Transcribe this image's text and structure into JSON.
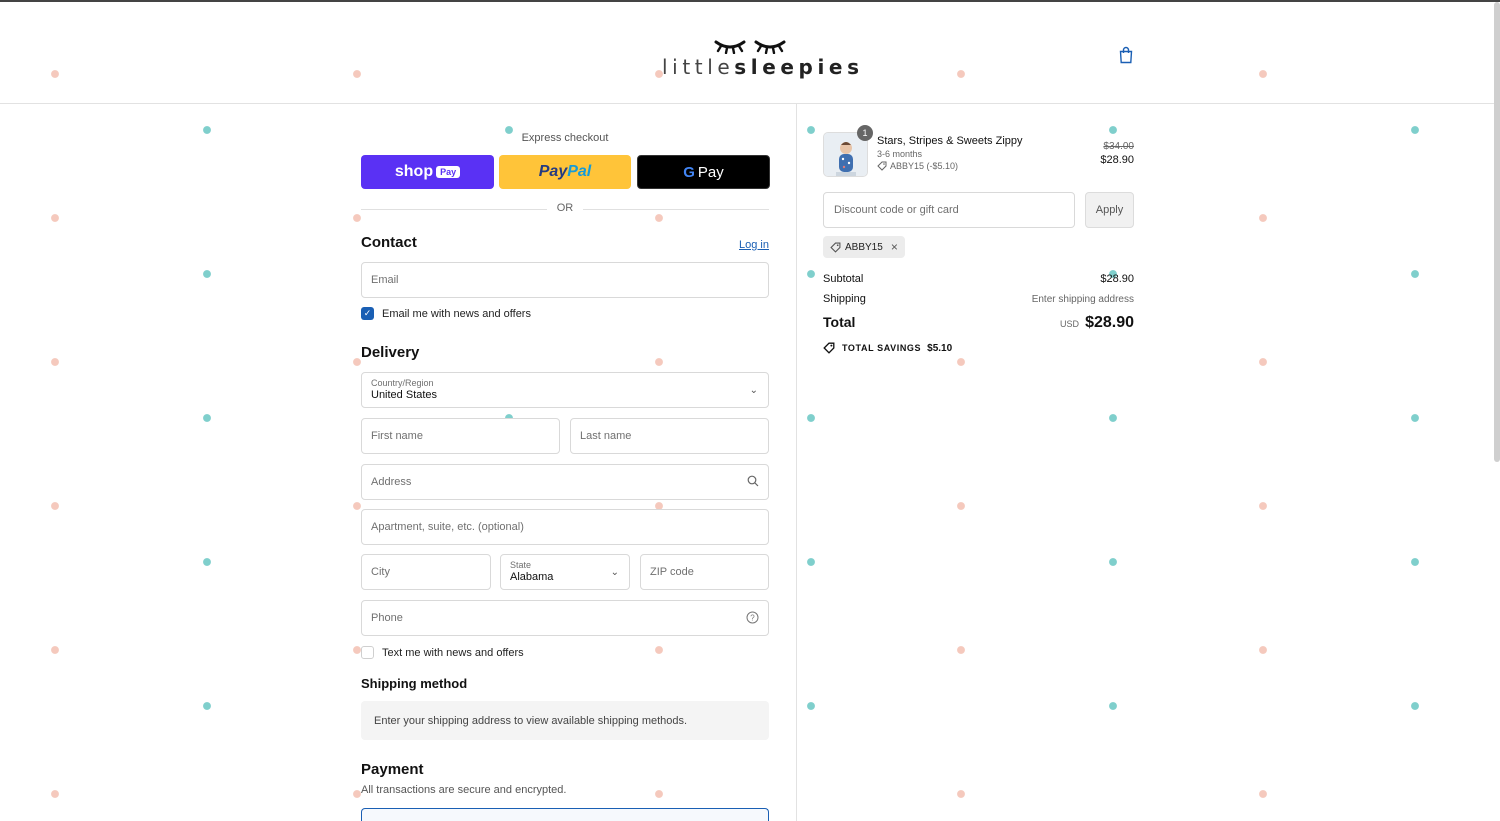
{
  "brand": {
    "name_light": "little",
    "name_bold": "sleepies"
  },
  "colors": {
    "shop_pay": "#5a31f4",
    "paypal": "#ffc439",
    "gpay": "#000000",
    "link": "#1a5fb4",
    "dot_teal": "#7fcfcc",
    "dot_pink": "#f5c9bd"
  },
  "express": {
    "title": "Express checkout",
    "shop_label": "shop",
    "shop_tag": "Pay",
    "paypal_part1": "Pay",
    "paypal_part2": "Pal",
    "gpay_g": "G",
    "gpay_label": "Pay",
    "or_label": "OR"
  },
  "contact": {
    "title": "Contact",
    "login_label": "Log in",
    "email_placeholder": "Email",
    "newsletter_label": "Email me with news and offers",
    "newsletter_checked": true
  },
  "delivery": {
    "title": "Delivery",
    "country_label": "Country/Region",
    "country_value": "United States",
    "first_name_placeholder": "First name",
    "last_name_placeholder": "Last name",
    "address_placeholder": "Address",
    "apartment_placeholder": "Apartment, suite, etc. (optional)",
    "city_placeholder": "City",
    "state_label": "State",
    "state_value": "Alabama",
    "zip_placeholder": "ZIP code",
    "phone_placeholder": "Phone",
    "sms_label": "Text me with news and offers",
    "sms_checked": false
  },
  "shipping_method": {
    "title": "Shipping method",
    "message": "Enter your shipping address to view available shipping methods."
  },
  "payment": {
    "title": "Payment",
    "subtitle": "All transactions are secure and encrypted."
  },
  "order": {
    "item": {
      "quantity": "1",
      "name": "Stars, Stripes & Sweets Zippy",
      "variant": "3-6 months",
      "discount_note": "ABBY15 (-$5.10)",
      "price_original": "$34.00",
      "price_final": "$28.90"
    },
    "discount_placeholder": "Discount code or gift card",
    "apply_label": "Apply",
    "applied_code": "ABBY15",
    "subtotal_label": "Subtotal",
    "subtotal_value": "$28.90",
    "shipping_label": "Shipping",
    "shipping_value": "Enter shipping address",
    "total_label": "Total",
    "currency": "USD",
    "total_value": "$28.90",
    "savings_label": "TOTAL SAVINGS",
    "savings_value": "$5.10"
  }
}
